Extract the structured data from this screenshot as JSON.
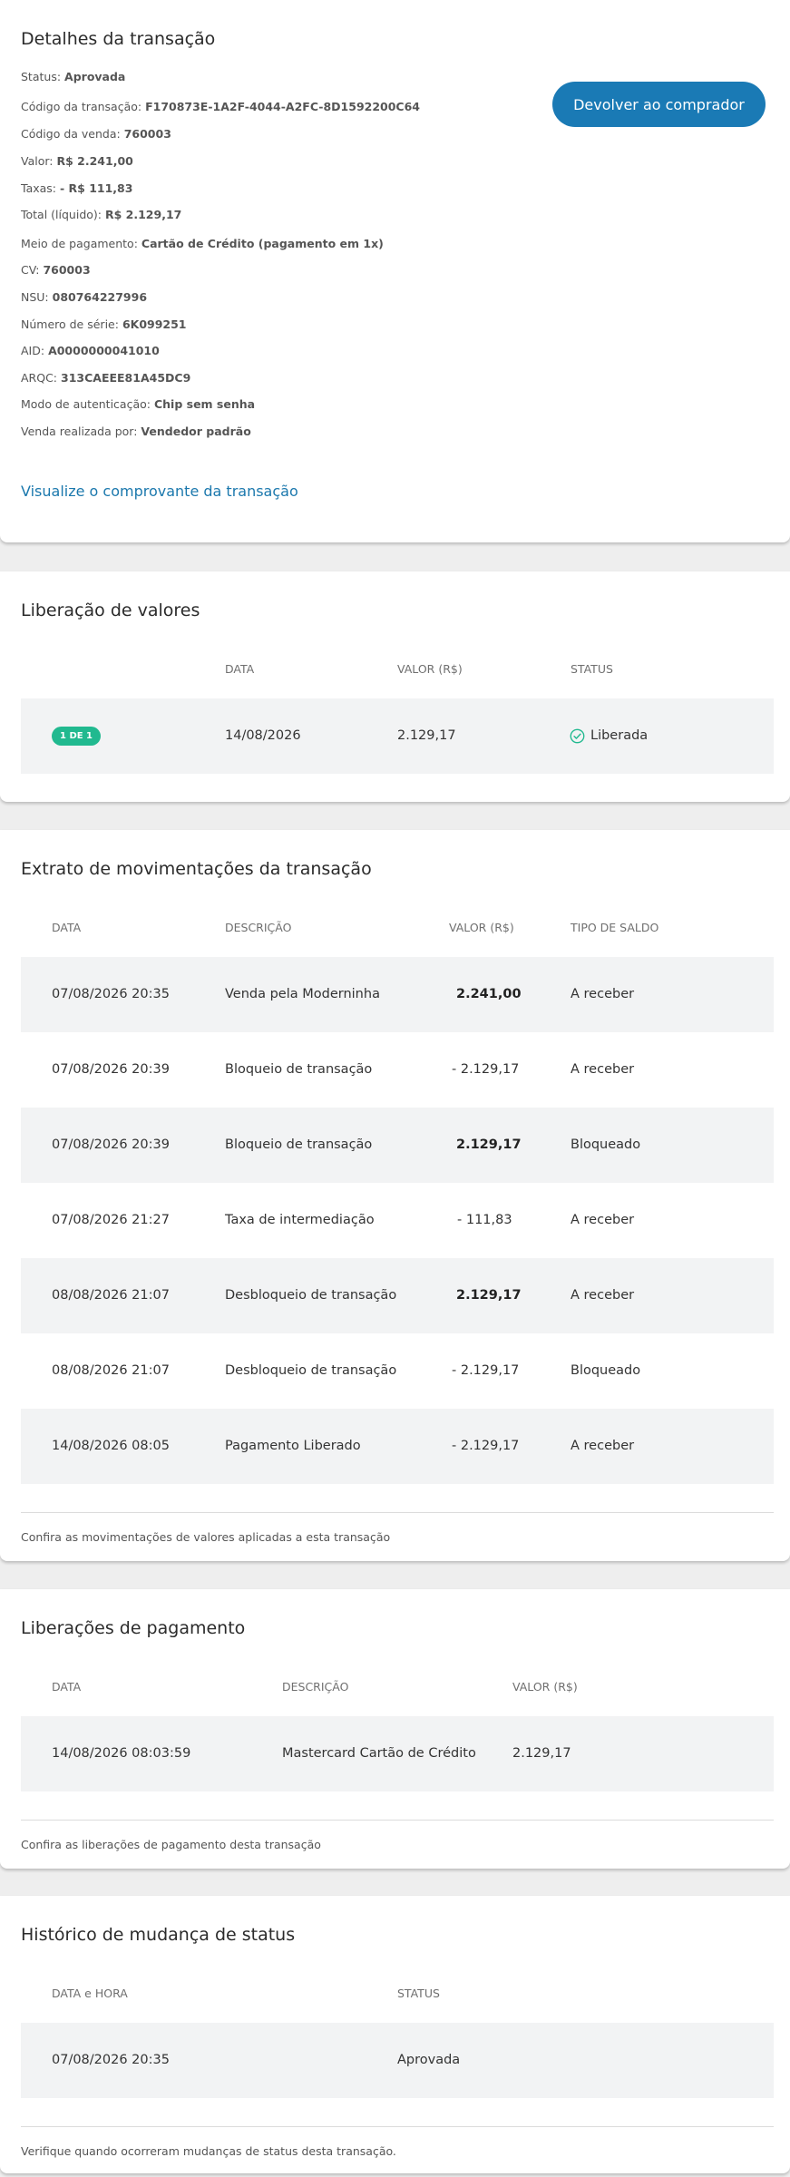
{
  "details": {
    "title": "Detalhes da transação",
    "refund_button": "Devolver ao comprador",
    "link": "Visualize o comprovante da transação",
    "fields": [
      {
        "label": "Status:",
        "value": "Aprovada"
      },
      {
        "label": "Código da transação:",
        "value": "F170873E-1A2F-4044-A2FC-8D1592200C64"
      },
      {
        "label": "Código da venda:",
        "value": "760003"
      },
      {
        "label": "Valor:",
        "value": "R$ 2.241,00"
      },
      {
        "label": "Taxas:",
        "value": "- R$ 111,83"
      },
      {
        "label": "Total (líquido):",
        "value": "R$ 2.129,17"
      },
      {
        "label": "Meio de pagamento:",
        "value": "Cartão de Crédito (pagamento em 1x)"
      },
      {
        "label": "CV:",
        "value": "760003"
      },
      {
        "label": "NSU:",
        "value": "080764227996"
      },
      {
        "label": "Número de série:",
        "value": "6K099251"
      },
      {
        "label": "AID:",
        "value": "A0000000041010"
      },
      {
        "label": "ARQC:",
        "value": "313CAEEE81A45DC9"
      },
      {
        "label": "Modo de autenticação:",
        "value": "Chip sem senha"
      },
      {
        "label": "Venda realizada por:",
        "value": "Vendedor padrão"
      }
    ]
  },
  "release": {
    "title": "Liberação de valores",
    "headers": [
      "DATA",
      "VALOR (R$)",
      "STATUS"
    ],
    "row": {
      "badge": "1 DE 1",
      "date": "14/08/2026",
      "value": "2.129,17",
      "status": "Liberada"
    }
  },
  "statement": {
    "title": "Extrato de movimentações da transação",
    "headers": [
      "DATA",
      "DESCRIÇÃO",
      "VALOR (R$)",
      "TIPO DE SALDO"
    ],
    "rows": [
      {
        "date": "07/08/2026 20:35",
        "description": "Venda pela Moderninha",
        "value": "2.241,00",
        "type": "A receber"
      },
      {
        "date": "07/08/2026 20:39",
        "description": "Bloqueio de transação",
        "value": "- 2.129,17",
        "type": "A receber"
      },
      {
        "date": "07/08/2026 20:39",
        "description": "Bloqueio de transação",
        "value": "2.129,17",
        "type": "Bloqueado"
      },
      {
        "date": "07/08/2026 21:27",
        "description": "Taxa de intermediação",
        "value": "- 111,83",
        "type": "A receber"
      },
      {
        "date": "08/08/2026 21:07",
        "description": "Desbloqueio de transação",
        "value": "2.129,17",
        "type": "A receber"
      },
      {
        "date": "08/08/2026 21:07",
        "description": "Desbloqueio de transação",
        "value": "- 2.129,17",
        "type": "Bloqueado"
      },
      {
        "date": "14/08/2026 08:05",
        "description": "Pagamento Liberado",
        "value": "- 2.129,17",
        "type": "A receber"
      }
    ],
    "footnote": "Confira as movimentações de valores aplicadas a esta transação"
  },
  "payments": {
    "title": "Liberações de pagamento",
    "headers": [
      "DATA",
      "DESCRIÇÃO",
      "VALOR (R$)"
    ],
    "row": {
      "date": "14/08/2026 08:03:59",
      "description": "Mastercard Cartão de Crédito",
      "value": "2.129,17"
    },
    "footnote": "Confira as liberações de pagamento desta transação"
  },
  "history": {
    "title": "Histórico de mudança de status",
    "headers": [
      "DATA e HORA",
      "STATUS"
    ],
    "row": {
      "datetime": "07/08/2026 20:35",
      "status": "Aprovada"
    },
    "footnote": "Verifique quando ocorreram mudanças de status desta transação."
  },
  "colors": {
    "accent": "#1a7ab5",
    "success": "#21b98f",
    "row_shade": "#f2f3f4"
  },
  "icons": {
    "liberada_status": "check-circle-icon"
  }
}
